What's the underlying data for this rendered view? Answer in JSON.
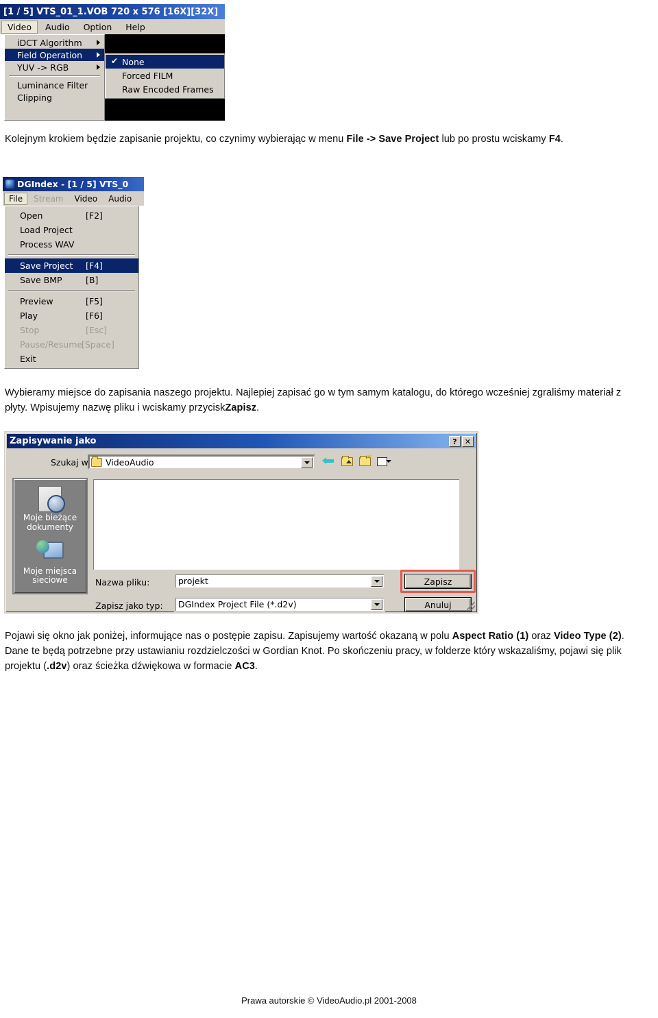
{
  "video_menu_shot": {
    "title": "[1 / 5] VTS_01_1.VOB 720 x 576 [16X][32X]",
    "menubar": [
      "Video",
      "Audio",
      "Option",
      "Help"
    ],
    "dropdown": [
      {
        "label": "iDCT Algorithm",
        "submenu": true
      },
      {
        "label": "Field Operation",
        "submenu": true,
        "selected": true
      },
      {
        "label": "YUV -> RGB",
        "submenu": true
      },
      {
        "label": "Luminance Filter"
      },
      {
        "label": "Clipping"
      }
    ],
    "submenu": [
      {
        "label": "None",
        "checked": true,
        "selected": true
      },
      {
        "label": "Forced FILM"
      },
      {
        "label": "Raw Encoded Frames"
      }
    ]
  },
  "para1": {
    "a": "Kolejnym krokiem będzie zapisanie projektu, co czynimy wybierając w menu ",
    "b": "File -> Save Project",
    "c": " lub po prostu wciskamy ",
    "d": "F4",
    "e": "."
  },
  "file_menu_shot": {
    "title": "DGIndex - [1 / 5] VTS_0",
    "menubar": [
      {
        "label": "File",
        "active": true
      },
      {
        "label": "Stream",
        "disabled": true
      },
      {
        "label": "Video"
      },
      {
        "label": "Audio"
      }
    ],
    "items": [
      {
        "label": "Open",
        "key": "[F2]"
      },
      {
        "label": "Load Project",
        "key": ""
      },
      {
        "label": "Process WAV",
        "key": ""
      },
      {
        "sep": true
      },
      {
        "label": "Save Project",
        "key": "[F4]",
        "selected": true
      },
      {
        "label": "Save BMP",
        "key": "[B]"
      },
      {
        "sep": true
      },
      {
        "label": "Preview",
        "key": "[F5]"
      },
      {
        "label": "Play",
        "key": "[F6]"
      },
      {
        "label": "Stop",
        "key": "[Esc]",
        "disabled": true
      },
      {
        "label": "Pause/Resume",
        "key": "[Space]",
        "disabled": true
      },
      {
        "label": "Exit",
        "key": ""
      }
    ]
  },
  "para2": {
    "a": "Wybieramy miejsce do zapisania naszego projektu. Najlepiej zapisać go w tym samym katalogu, do którego wcześniej zgraliśmy materiał z płyty. Wpisujemy nazwę pliku i wciskamy przycisk",
    "b": "Zapisz",
    "c": "."
  },
  "save_dialog": {
    "title": "Zapisywanie jako",
    "help_button": "?",
    "close_button": "✕",
    "lookin_label": "Szukaj w:",
    "lookin_value": "VideoAudio",
    "toolbar_icons": [
      "back-icon",
      "up-one-level-icon",
      "new-folder-icon",
      "views-icon"
    ],
    "places": [
      {
        "icon": "recent-documents-icon",
        "line1": "Moje bieżące",
        "line2": "dokumenty"
      },
      {
        "icon": "network-places-icon",
        "line1": "Moje miejsca",
        "line2": "sieciowe"
      }
    ],
    "filename_label": "Nazwa pliku:",
    "filename_value": "projekt",
    "filetype_label": "Zapisz jako typ:",
    "filetype_value": "DGIndex Project File (*.d2v)",
    "save_button": "Zapisz",
    "cancel_button": "Anuluj",
    "highlight_color": "#e8584f"
  },
  "para3": {
    "a": "Pojawi się okno jak poniżej, informujące nas o postępie zapisu. Zapisujemy wartość okazaną w polu ",
    "b": "Aspect Ratio (1)",
    "c": " oraz ",
    "d": "Video Type (2)",
    "e": ". Dane te będą potrzebne przy ustawianiu rozdzielczości w Gordian Knot. Po skończeniu pracy, w folderze który wskazaliśmy, pojawi się plik projektu (",
    "f": ".d2v",
    "g": ") oraz ścieżka dźwiękowa w formacie ",
    "h": "AC3",
    "i": "."
  },
  "footer": "Prawa autorskie © VideoAudio.pl 2001-2008"
}
